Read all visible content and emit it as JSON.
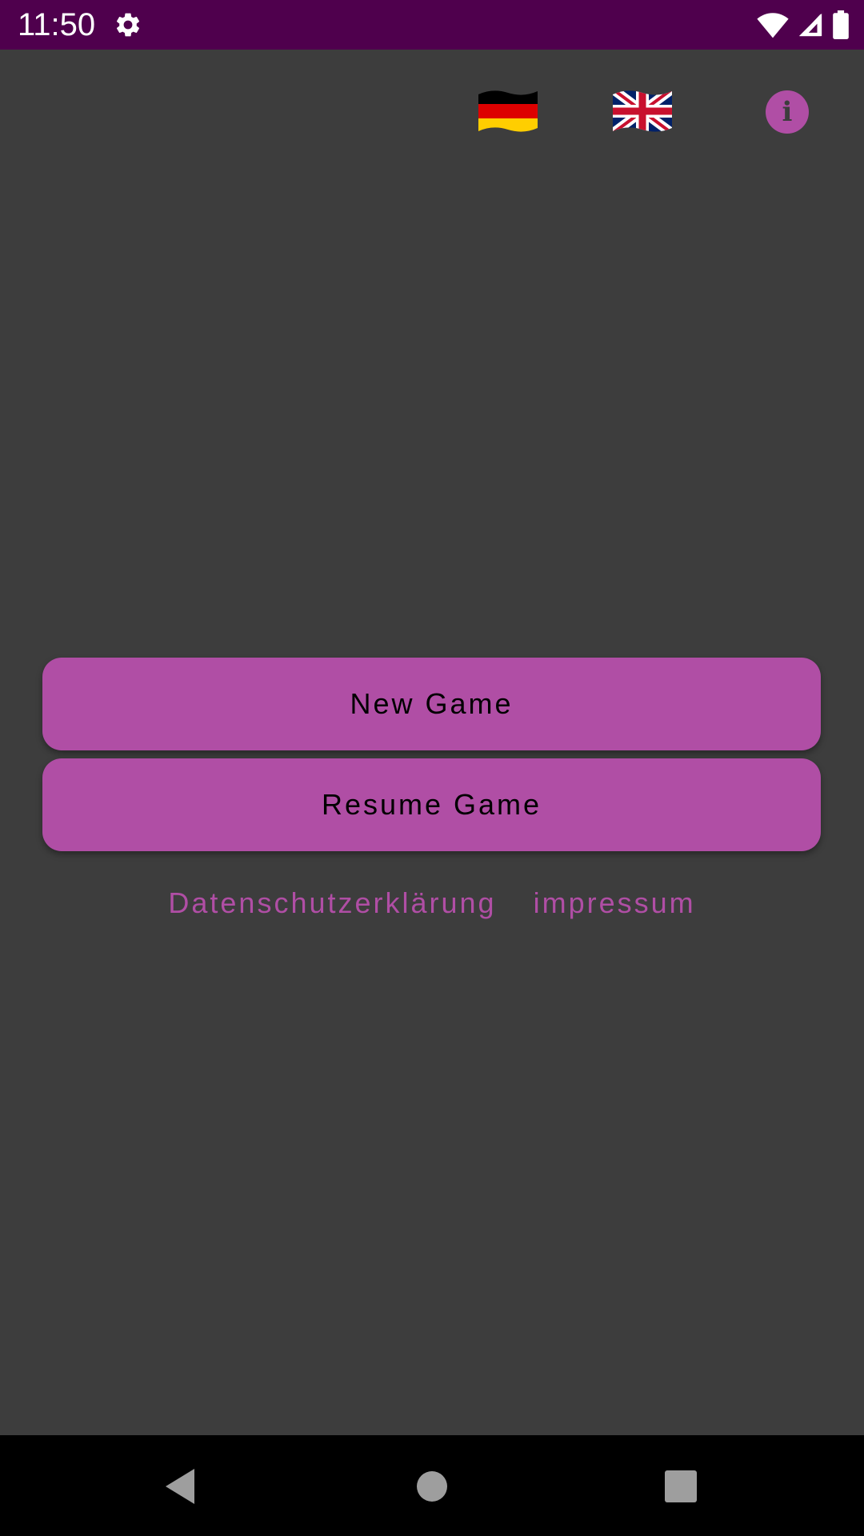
{
  "status_bar": {
    "time": "11:50",
    "icons": [
      "gear-icon",
      "wifi-icon",
      "signal-icon",
      "battery-icon"
    ]
  },
  "header": {
    "flags": [
      "german-flag-icon",
      "uk-flag-icon"
    ],
    "info_icon": "i"
  },
  "main": {
    "new_game_label": "New Game",
    "resume_game_label": "Resume Game"
  },
  "footer_links": {
    "privacy_label": "Datenschutzerklärung",
    "imprint_label": "impressum"
  },
  "colors": {
    "status_bar": "#4f004d",
    "background": "#3d3d3d",
    "accent": "#b04ea5",
    "nav_bar": "#000000"
  }
}
